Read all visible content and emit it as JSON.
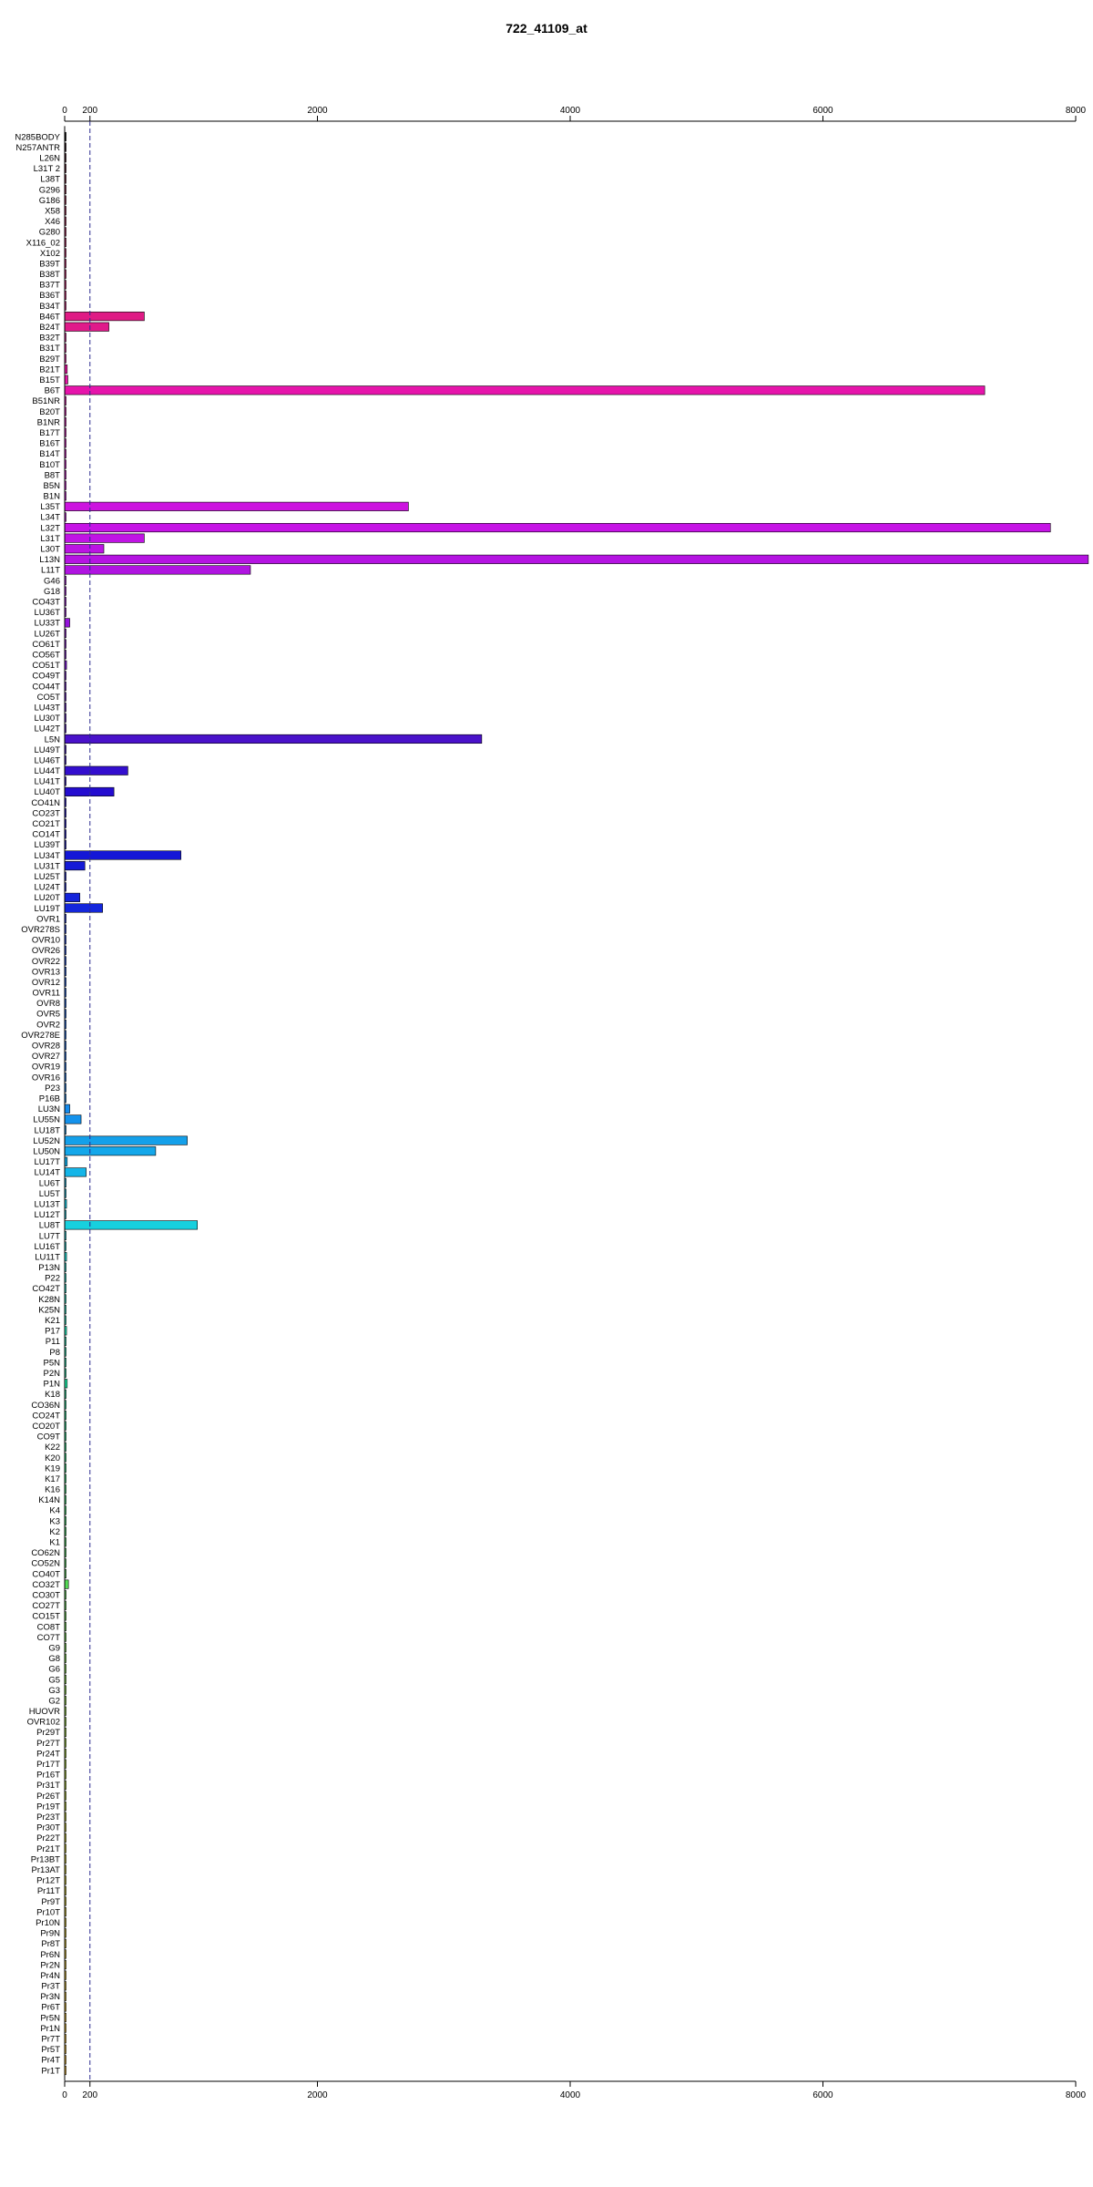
{
  "chart_data": {
    "type": "bar",
    "orientation": "horizontal",
    "title": "722_41109_at",
    "xlim": [
      0,
      8000
    ],
    "x_ticks": [
      0,
      200,
      2000,
      4000,
      6000,
      8000
    ],
    "reference_line": 200,
    "categories": [
      "N285BODY",
      "N257ANTR",
      "L26N",
      "L31T 2",
      "L38T",
      "G296",
      "G186",
      "X58",
      "X46",
      "G280",
      "X116_02",
      "X102",
      "B39T",
      "B38T",
      "B37T",
      "B36T",
      "B34T",
      "B46T",
      "B24T",
      "B32T",
      "B31T",
      "B29T",
      "B21T",
      "B15T",
      "B6T",
      "B51NR",
      "B20T",
      "B1NR",
      "B17T",
      "B16T",
      "B14T",
      "B10T",
      "B8T",
      "B5N",
      "B1N",
      "L35T",
      "L34T",
      "L32T",
      "L31T",
      "L30T",
      "L13N",
      "L11T",
      "G46",
      "G18",
      "CO43T",
      "LU36T",
      "LU33T",
      "LU26T",
      "CO61T",
      "CO56T",
      "CO51T",
      "CO49T",
      "CO44T",
      "CO5T",
      "LU43T",
      "LU30T",
      "LU42T",
      "L5N",
      "LU49T",
      "LU46T",
      "LU44T",
      "LU41T",
      "LU40T",
      "CO41N",
      "CO23T",
      "CO21T",
      "CO14T",
      "LU39T",
      "LU34T",
      "LU31T",
      "LU25T",
      "LU24T",
      "LU20T",
      "LU19T",
      "OVR1",
      "OVR278S",
      "OVR10",
      "OVR26",
      "OVR22",
      "OVR13",
      "OVR12",
      "OVR11",
      "OVR8",
      "OVR5",
      "OVR2",
      "OVR278E",
      "OVR28",
      "OVR27",
      "OVR19",
      "OVR16",
      "P23",
      "P16B",
      "LU3N",
      "LU55N",
      "LU18T",
      "LU52N",
      "LU50N",
      "LU17T",
      "LU14T",
      "LU6T",
      "LU5T",
      "LU13T",
      "LU12T",
      "LU8T",
      "LU7T",
      "LU16T",
      "LU11T",
      "P13N",
      "P22",
      "CO42T",
      "K28N",
      "K25N",
      "K21",
      "P17",
      "P11",
      "P8",
      "P5N",
      "P2N",
      "P1N",
      "K18",
      "CO36N",
      "CO24T",
      "CO20T",
      "CO9T",
      "K22",
      "K20",
      "K19",
      "K17",
      "K16",
      "K14N",
      "K4",
      "K3",
      "K2",
      "K1",
      "CO62N",
      "CO52N",
      "CO40T",
      "CO32T",
      "CO30T",
      "CO27T",
      "CO15T",
      "CO8T",
      "CO7T",
      "G9",
      "G8",
      "G6",
      "G5",
      "G3",
      "G2",
      "HUOVR",
      "OVR102",
      "Pr29T",
      "Pr27T",
      "Pr24T",
      "Pr17T",
      "Pr16T",
      "Pr31T",
      "Pr26T",
      "Pr19T",
      "Pr23T",
      "Pr30T",
      "Pr22T",
      "Pr21T",
      "Pr13BT",
      "Pr13AT",
      "Pr12T",
      "Pr11T",
      "Pr9T",
      "Pr10T",
      "Pr10N",
      "Pr9N",
      "Pr8T",
      "Pr6N",
      "Pr2N",
      "Pr4N",
      "Pr3T",
      "Pr3N",
      "Pr6T",
      "Pr5N",
      "Pr1N",
      "Pr7T",
      "Pr5T",
      "Pr4T",
      "Pr1T"
    ],
    "values": [
      5,
      5,
      5,
      5,
      5,
      5,
      5,
      5,
      5,
      5,
      5,
      5,
      5,
      5,
      5,
      5,
      5,
      630,
      350,
      5,
      5,
      5,
      20,
      25,
      7280,
      5,
      5,
      5,
      5,
      5,
      5,
      5,
      5,
      5,
      5,
      2720,
      5,
      7800,
      630,
      310,
      8100,
      1470,
      5,
      5,
      5,
      5,
      40,
      5,
      5,
      5,
      15,
      5,
      5,
      5,
      5,
      5,
      5,
      3300,
      5,
      5,
      500,
      5,
      390,
      5,
      5,
      5,
      5,
      5,
      920,
      160,
      5,
      5,
      120,
      300,
      5,
      5,
      5,
      5,
      5,
      5,
      5,
      5,
      5,
      5,
      5,
      5,
      5,
      5,
      5,
      5,
      5,
      5,
      40,
      130,
      5,
      970,
      720,
      20,
      170,
      5,
      5,
      15,
      5,
      1050,
      5,
      5,
      15,
      5,
      5,
      5,
      5,
      5,
      5,
      15,
      5,
      5,
      5,
      5,
      20,
      5,
      5,
      5,
      5,
      5,
      5,
      5,
      5,
      5,
      5,
      5,
      5,
      5,
      5,
      5,
      5,
      5,
      5,
      30,
      5,
      5,
      5,
      5,
      5,
      5,
      5,
      5,
      5,
      5,
      5,
      5,
      5,
      5,
      10,
      10,
      10,
      10,
      10,
      5,
      5,
      5,
      5,
      5,
      5,
      5,
      5,
      5,
      5,
      5,
      5,
      5,
      5,
      5,
      5,
      5,
      5,
      5,
      5,
      5,
      5,
      5,
      5,
      5,
      5,
      5,
      5,
      5
    ]
  }
}
